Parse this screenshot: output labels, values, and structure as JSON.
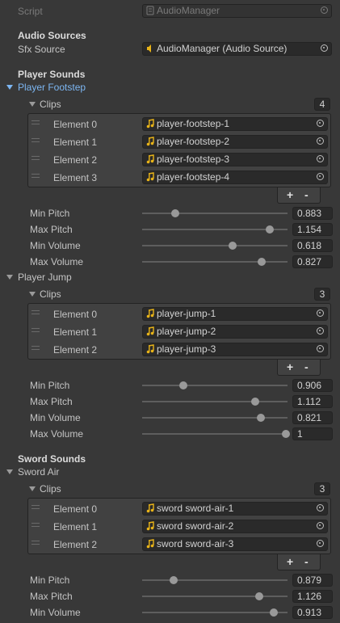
{
  "script": {
    "label": "Script",
    "value": "AudioManager"
  },
  "audio_sources": {
    "header": "Audio Sources",
    "sfx_label": "Sfx Source",
    "sfx_value": "AudioManager (Audio Source)"
  },
  "player_sounds": {
    "header": "Player Sounds",
    "footstep": {
      "name": "Player Footstep",
      "clips_label": "Clips",
      "count": "4",
      "elements": [
        {
          "label": "Element 0",
          "value": "player-footstep-1"
        },
        {
          "label": "Element 1",
          "value": "player-footstep-2"
        },
        {
          "label": "Element 2",
          "value": "player-footstep-3"
        },
        {
          "label": "Element 3",
          "value": "player-footstep-4"
        }
      ],
      "min_pitch": {
        "label": "Min Pitch",
        "value": "0.883"
      },
      "max_pitch": {
        "label": "Max Pitch",
        "value": "1.154"
      },
      "min_volume": {
        "label": "Min Volume",
        "value": "0.618"
      },
      "max_volume": {
        "label": "Max Volume",
        "value": "0.827"
      }
    },
    "jump": {
      "name": "Player Jump",
      "clips_label": "Clips",
      "count": "3",
      "elements": [
        {
          "label": "Element 0",
          "value": "player-jump-1"
        },
        {
          "label": "Element 1",
          "value": "player-jump-2"
        },
        {
          "label": "Element 2",
          "value": "player-jump-3"
        }
      ],
      "min_pitch": {
        "label": "Min Pitch",
        "value": "0.906"
      },
      "max_pitch": {
        "label": "Max Pitch",
        "value": "1.112"
      },
      "min_volume": {
        "label": "Min Volume",
        "value": "0.821"
      },
      "max_volume": {
        "label": "Max Volume",
        "value": "1"
      }
    }
  },
  "sword_sounds": {
    "header": "Sword Sounds",
    "air": {
      "name": "Sword Air",
      "clips_label": "Clips",
      "count": "3",
      "elements": [
        {
          "label": "Element 0",
          "value": "sword sword-air-1"
        },
        {
          "label": "Element 1",
          "value": "sword sword-air-2"
        },
        {
          "label": "Element 2",
          "value": "sword sword-air-3"
        }
      ],
      "min_pitch": {
        "label": "Min Pitch",
        "value": "0.879"
      },
      "max_pitch": {
        "label": "Max Pitch",
        "value": "1.126"
      },
      "min_volume": {
        "label": "Min Volume",
        "value": "0.913"
      }
    }
  },
  "buttons": {
    "plus": "+",
    "minus": "-"
  },
  "icons": {
    "script": "script-icon",
    "audio_source": "speaker-icon",
    "clip": "music-note-icon",
    "picker": "object-picker-icon"
  },
  "colors": {
    "background": "#383838",
    "accent": "#7cb6f2",
    "clip_icon": "#e8b318",
    "field": "#2a2a2a"
  }
}
